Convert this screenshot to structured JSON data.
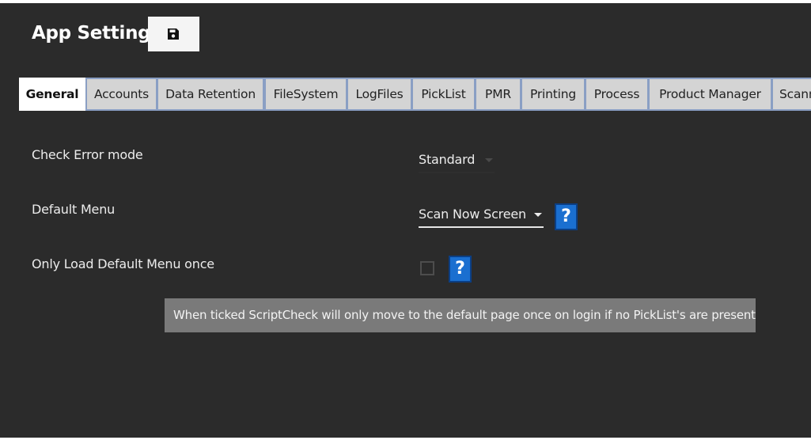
{
  "header": {
    "title": "App Settings",
    "save_icon": "floppy-disk-icon"
  },
  "tabs": [
    {
      "label": "General",
      "active": true
    },
    {
      "label": "Accounts"
    },
    {
      "label": "Data Retention"
    },
    {
      "label": "FileSystem"
    },
    {
      "label": "LogFiles"
    },
    {
      "label": "PickList"
    },
    {
      "label": "PMR"
    },
    {
      "label": "Printing"
    },
    {
      "label": "Process"
    },
    {
      "label": "Product Manager"
    },
    {
      "label": "Scann"
    }
  ],
  "settings": {
    "check_error_mode": {
      "label": "Check Error mode",
      "value": "Standard"
    },
    "default_menu": {
      "label": "Default Menu",
      "value": "Scan Now Screen",
      "help": "?"
    },
    "only_load_default_menu_once": {
      "label": "Only Load Default Menu once",
      "checked": false,
      "help": "?"
    }
  },
  "tooltip": {
    "text": "When ticked ScriptCheck will only move to the default page once on login if no PickList's are present."
  },
  "colors": {
    "background": "#2b2b2b",
    "tab_border": "#8a9fc4",
    "help_button": "#1a6fd0",
    "tooltip_background": "#7a7a7a"
  }
}
